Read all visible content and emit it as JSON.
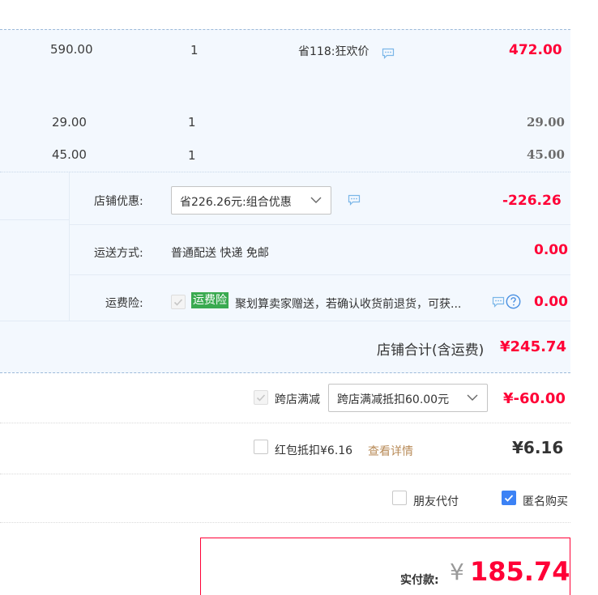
{
  "items": [
    {
      "price": "590.00",
      "qty": "1",
      "promo": "省118:狂欢价",
      "total": "472.00"
    },
    {
      "price": "29.00",
      "qty": "1",
      "total": "29.00"
    },
    {
      "price": "45.00",
      "qty": "1",
      "total": "45.00"
    }
  ],
  "shop": {
    "discount_label": "店铺优惠:",
    "discount_select": "省226.26元:组合优惠",
    "discount_value": "-226.26",
    "shipping_label": "运送方式:",
    "shipping_value": "普通配送 快递 免邮",
    "shipping_cost": "0.00",
    "insurance_label": "运费险:",
    "insurance_badge": "运费险",
    "insurance_desc": "聚划算卖家赠送，若确认收货前退货，可获...",
    "insurance_cost": "0.00",
    "total_label": "店铺合计(含运费)",
    "total_value": "¥245.74"
  },
  "cross_store": {
    "label": "跨店满减",
    "select": "跨店满减抵扣60.00元",
    "value": "¥-60.00"
  },
  "red_packet": {
    "label": "红包抵扣¥6.16",
    "link": "查看详情",
    "value": "¥6.16"
  },
  "options": {
    "friend_pay": "朋友代付",
    "anonymous": "匿名购买"
  },
  "payment": {
    "label": "实付款:",
    "currency": "¥",
    "amount": "185.74"
  },
  "colors": {
    "accent_red": "#ff0036",
    "checkbox_blue": "#3c82f5",
    "badge_green": "#3aaa4f"
  }
}
